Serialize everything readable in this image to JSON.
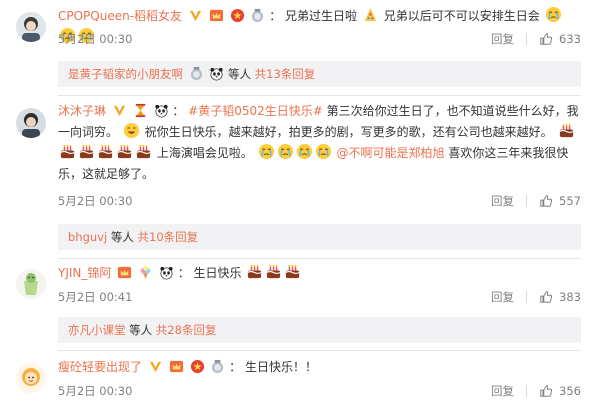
{
  "comments": [
    {
      "username": "CPOPQueen-稻稻女友",
      "separator": "：",
      "text_a": "兄弟过生日啦",
      "text_b": "兄弟以后可不可以安排生日会",
      "time": "5月2日 00:30",
      "reply_label": "回复",
      "likes": "633",
      "subreply": {
        "who": "是黄子韬家的小朋友啊",
        "mid": "等人",
        "more": "共13条回复"
      }
    },
    {
      "username": "沐沐子琳",
      "separator": "：",
      "topic": "#黄子韬0502生日快乐#",
      "text_a": " 第三次给你过生日了，也不知道说些什么好，我一向词穷。",
      "text_b": "祝你生日快乐，越来越好，拍更多的剧，写更多的歌，还有公司也越来越好。",
      "text_c": "上海演唱会见啦。",
      "mention": "@不啊可能是郑柏旭",
      "text_d": " 喜欢你这三年来我很快乐，这就足够了。",
      "time": "5月2日 00:30",
      "reply_label": "回复",
      "likes": "557",
      "subreply": {
        "who": "bhguvj",
        "mid": "等人",
        "more": "共10条回复"
      }
    },
    {
      "username": "YJIN_锦阿",
      "separator": "：",
      "text_a": "生日快乐",
      "time": "5月2日 00:41",
      "reply_label": "回复",
      "likes": "383",
      "subreply": {
        "who": "亦凡小课堂",
        "mid": "等人",
        "more": "共28条回复"
      }
    },
    {
      "username": "瘦砼轻要出现了",
      "separator": "：",
      "text_a": "生日快乐！！",
      "time": "5月2日 00:30",
      "reply_label": "回复",
      "likes": "356"
    }
  ],
  "colors": {
    "link": "#eb7350",
    "meta": "#808080",
    "subreply_bg": "#f2f2f5"
  }
}
